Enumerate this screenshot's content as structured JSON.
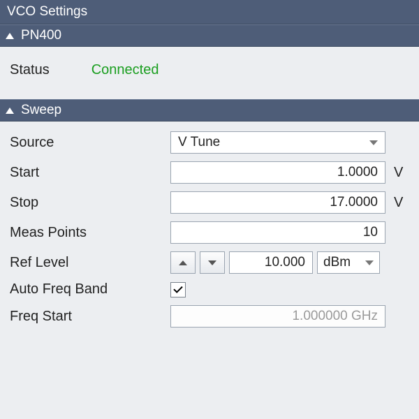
{
  "panel": {
    "title": "VCO Settings"
  },
  "sections": {
    "device": {
      "name": "PN400"
    },
    "sweep": {
      "name": "Sweep"
    }
  },
  "status": {
    "label": "Status",
    "value": "Connected"
  },
  "sweep": {
    "source": {
      "label": "Source",
      "selected": "V Tune"
    },
    "start": {
      "label": "Start",
      "value": "1.0000",
      "unit": "V"
    },
    "stop": {
      "label": "Stop",
      "value": "17.0000",
      "unit": "V"
    },
    "meas_points": {
      "label": "Meas Points",
      "value": "10"
    },
    "ref_level": {
      "label": "Ref Level",
      "value": "10.000",
      "unit": "dBm"
    },
    "auto_freq_band": {
      "label": "Auto Freq Band",
      "checked": true
    },
    "freq_start": {
      "label": "Freq Start",
      "value": "1.000000 GHz"
    }
  }
}
